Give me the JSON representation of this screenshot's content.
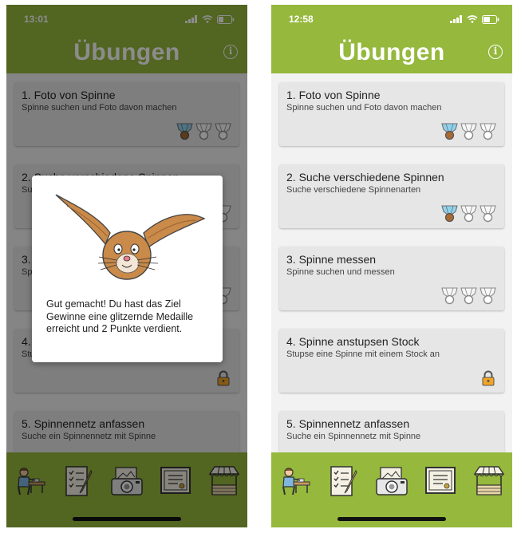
{
  "colors": {
    "green": "#95b83d",
    "green_dim": "#55691f",
    "card": "#e6e6e6"
  },
  "screens": [
    {
      "status": {
        "time": "13:01"
      },
      "header": {
        "title": "Übungen"
      },
      "cards": [
        {
          "title": "1. Foto von Spinne",
          "subtitle": "Spinne suchen und Foto davon machen",
          "medals": [
            "bronze",
            "empty",
            "empty"
          ]
        },
        {
          "title": "2. Suche verschiedene Spinnen",
          "subtitle": "Su",
          "medals": [
            "bronze",
            "empty",
            "empty"
          ]
        },
        {
          "title": "3.",
          "subtitle": "Sp",
          "medals": [
            "empty",
            "empty",
            "empty"
          ]
        },
        {
          "title": "4.",
          "subtitle": "Stu",
          "locked": true
        },
        {
          "title": "5. Spinnennetz anfassen",
          "subtitle": "Suche ein Spinnennetz mit Spinne",
          "locked": true
        }
      ],
      "dialog": {
        "message": "Gut gemacht! Du hast das Ziel Gewinne eine glitzernde Medaille erreicht und  2 Punkte verdient."
      }
    },
    {
      "status": {
        "time": "12:58"
      },
      "header": {
        "title": "Übungen"
      },
      "cards": [
        {
          "title": "1. Foto von Spinne",
          "subtitle": "Spinne suchen und Foto davon machen",
          "medals": [
            "bronze",
            "empty",
            "empty"
          ]
        },
        {
          "title": "2. Suche verschiedene Spinnen",
          "subtitle": "Suche verschiedene Spinnenarten",
          "medals": [
            "bronze",
            "empty",
            "empty"
          ]
        },
        {
          "title": "3. Spinne messen",
          "subtitle": "Spinne suchen und messen",
          "medals": [
            "empty",
            "empty",
            "empty"
          ]
        },
        {
          "title": "4. Spinne anstupsen Stock",
          "subtitle": "Stupse eine Spinne mit einem Stock an",
          "locked": true
        },
        {
          "title": "5. Spinnennetz anfassen",
          "subtitle": "Suche ein Spinnennetz mit Spinne",
          "locked": true
        }
      ]
    }
  ],
  "tabbar": {
    "tabs": [
      "student-icon",
      "checklist-icon",
      "camera-icon",
      "certificate-icon",
      "market-stall-icon"
    ]
  }
}
